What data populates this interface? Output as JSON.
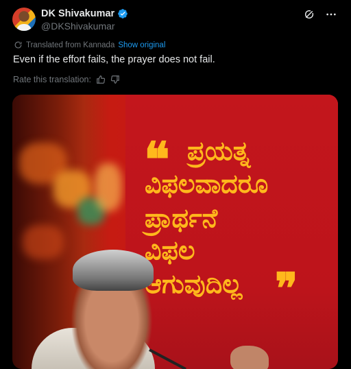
{
  "tweet": {
    "display_name": "DK Shivakumar",
    "handle": "@DKShivakumar",
    "translated_from": "Translated from Kannada",
    "show_original": "Show original",
    "text": "Even if the effort fails, the prayer does not fail.",
    "rate_label": "Rate this translation:"
  },
  "media": {
    "quote_lines": [
      "ಪ್ರಯತ್ನ",
      "ವಿಫಲವಾದರೂ",
      "ಪ್ರಾರ್ಥನೆ",
      "ವಿಫಲ",
      "ಆಗುವುದಿಲ್ಲ"
    ],
    "open_quote": "❝",
    "close_quote": "❞"
  },
  "colors": {
    "background": "#000000",
    "text": "#e7e9ea",
    "muted": "#71767b",
    "link": "#1d9bf0",
    "verified": "#1d9bf0",
    "poster_red": "#c3161c",
    "poster_yellow": "#ffb81c"
  },
  "icons": [
    "verified-badge-icon",
    "grok-icon",
    "more-icon",
    "translate-icon",
    "thumbs-up-icon",
    "thumbs-down-icon"
  ]
}
